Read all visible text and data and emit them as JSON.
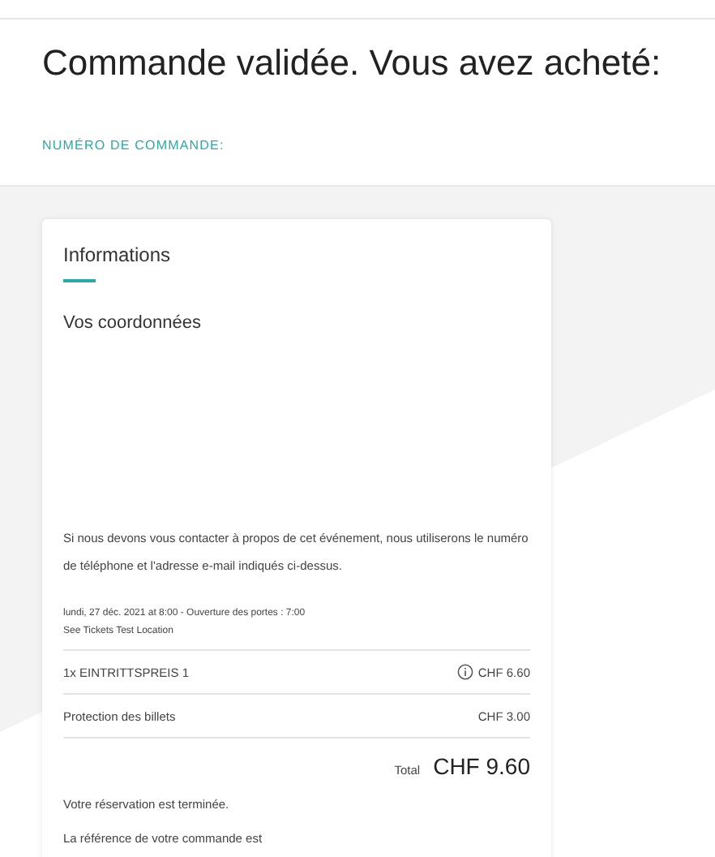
{
  "heading": "Commande validée. Vous avez acheté:",
  "order_number_label": "NUMÉRO DE COMMANDE:",
  "card": {
    "title": "Informations",
    "section_title": "Vos coordonnées",
    "contact_note": "Si nous devons vous contacter à propos de cet événement, nous utiliserons le numéro de téléphone et l'adresse e-mail indiqués ci-dessus.",
    "event_date": "lundi, 27 déc. 2021 at 8:00 - Ouverture des portes : 7:00",
    "event_location": "See Tickets Test Location",
    "items": [
      {
        "name": "1x EINTRITTSPREIS 1",
        "info_icon": true,
        "price": "CHF 6.60"
      },
      {
        "name": "Protection des billets",
        "info_icon": false,
        "price": "CHF 3.00"
      }
    ],
    "total_label": "Total",
    "total_value": "CHF 9.60",
    "messages": [
      "Votre réservation est terminée.",
      "La référence de votre commande est"
    ]
  }
}
